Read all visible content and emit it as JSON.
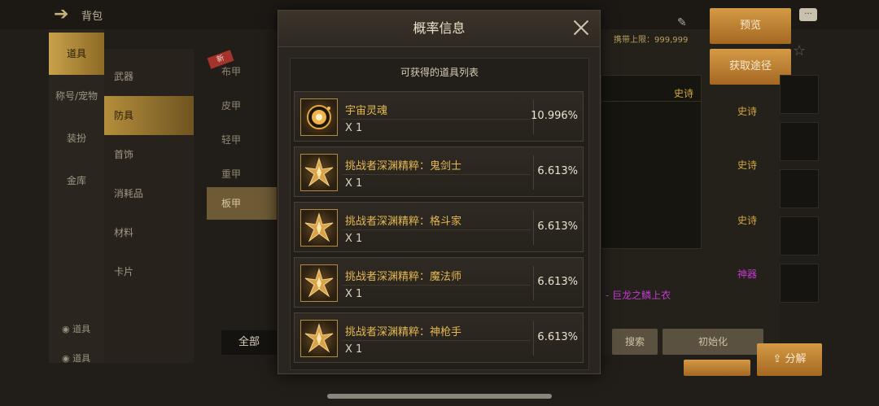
{
  "background": {
    "top_title": "背包",
    "top_small": "",
    "left_nav": [
      {
        "label": "道具",
        "active": true
      },
      {
        "label": "称号/宠物",
        "active": false
      },
      {
        "label": "装扮",
        "active": false
      },
      {
        "label": "金库",
        "active": false
      }
    ],
    "sub_nav": [
      {
        "label": "武器",
        "active": false
      },
      {
        "label": "防具",
        "active": true
      },
      {
        "label": "首饰",
        "active": false
      },
      {
        "label": "消耗品",
        "active": false
      },
      {
        "label": "材料",
        "active": false
      },
      {
        "label": "卡片",
        "active": false
      }
    ],
    "third_nav": [
      {
        "label": "布甲",
        "active": false
      },
      {
        "label": "皮甲",
        "active": false
      },
      {
        "label": "轻甲",
        "active": false
      },
      {
        "label": "重甲",
        "active": false
      },
      {
        "label": "板甲",
        "active": true
      }
    ],
    "new_tag": "新",
    "all_button": "全部",
    "bottom_links": [
      "道具",
      "道具"
    ],
    "capacity_label": "携带上限：",
    "capacity_value": "999,999",
    "preview_button": "预览",
    "obtain_button": "获取途径",
    "epic_labels": [
      "史诗",
      "史诗",
      "史诗",
      "史诗"
    ],
    "legend_label": "神器",
    "magenta_item": "- 巨龙之鳞上衣",
    "search_button": "搜索",
    "reset_button": "初始化",
    "decompose_button": "分解",
    "chat_icon": "chat-bubble-icon"
  },
  "modal": {
    "title": "概率信息",
    "list_title": "可获得的道具列表",
    "items": [
      {
        "name": "宇宙灵魂",
        "qty": "X 1",
        "pct": "10.996%",
        "icon": "cosmic-soul-icon"
      },
      {
        "name": "挑战者深渊精粹：鬼剑士",
        "qty": "X 1",
        "pct": "6.613%",
        "icon": "abyss-essence-icon"
      },
      {
        "name": "挑战者深渊精粹：格斗家",
        "qty": "X 1",
        "pct": "6.613%",
        "icon": "abyss-essence-icon"
      },
      {
        "name": "挑战者深渊精粹：魔法师",
        "qty": "X 1",
        "pct": "6.613%",
        "icon": "abyss-essence-icon"
      },
      {
        "name": "挑战者深渊精粹：神枪手",
        "qty": "X 1",
        "pct": "6.613%",
        "icon": "abyss-essence-icon"
      }
    ],
    "colors": {
      "item_name": "#e5b851",
      "frame_border": "#b08a45"
    }
  }
}
